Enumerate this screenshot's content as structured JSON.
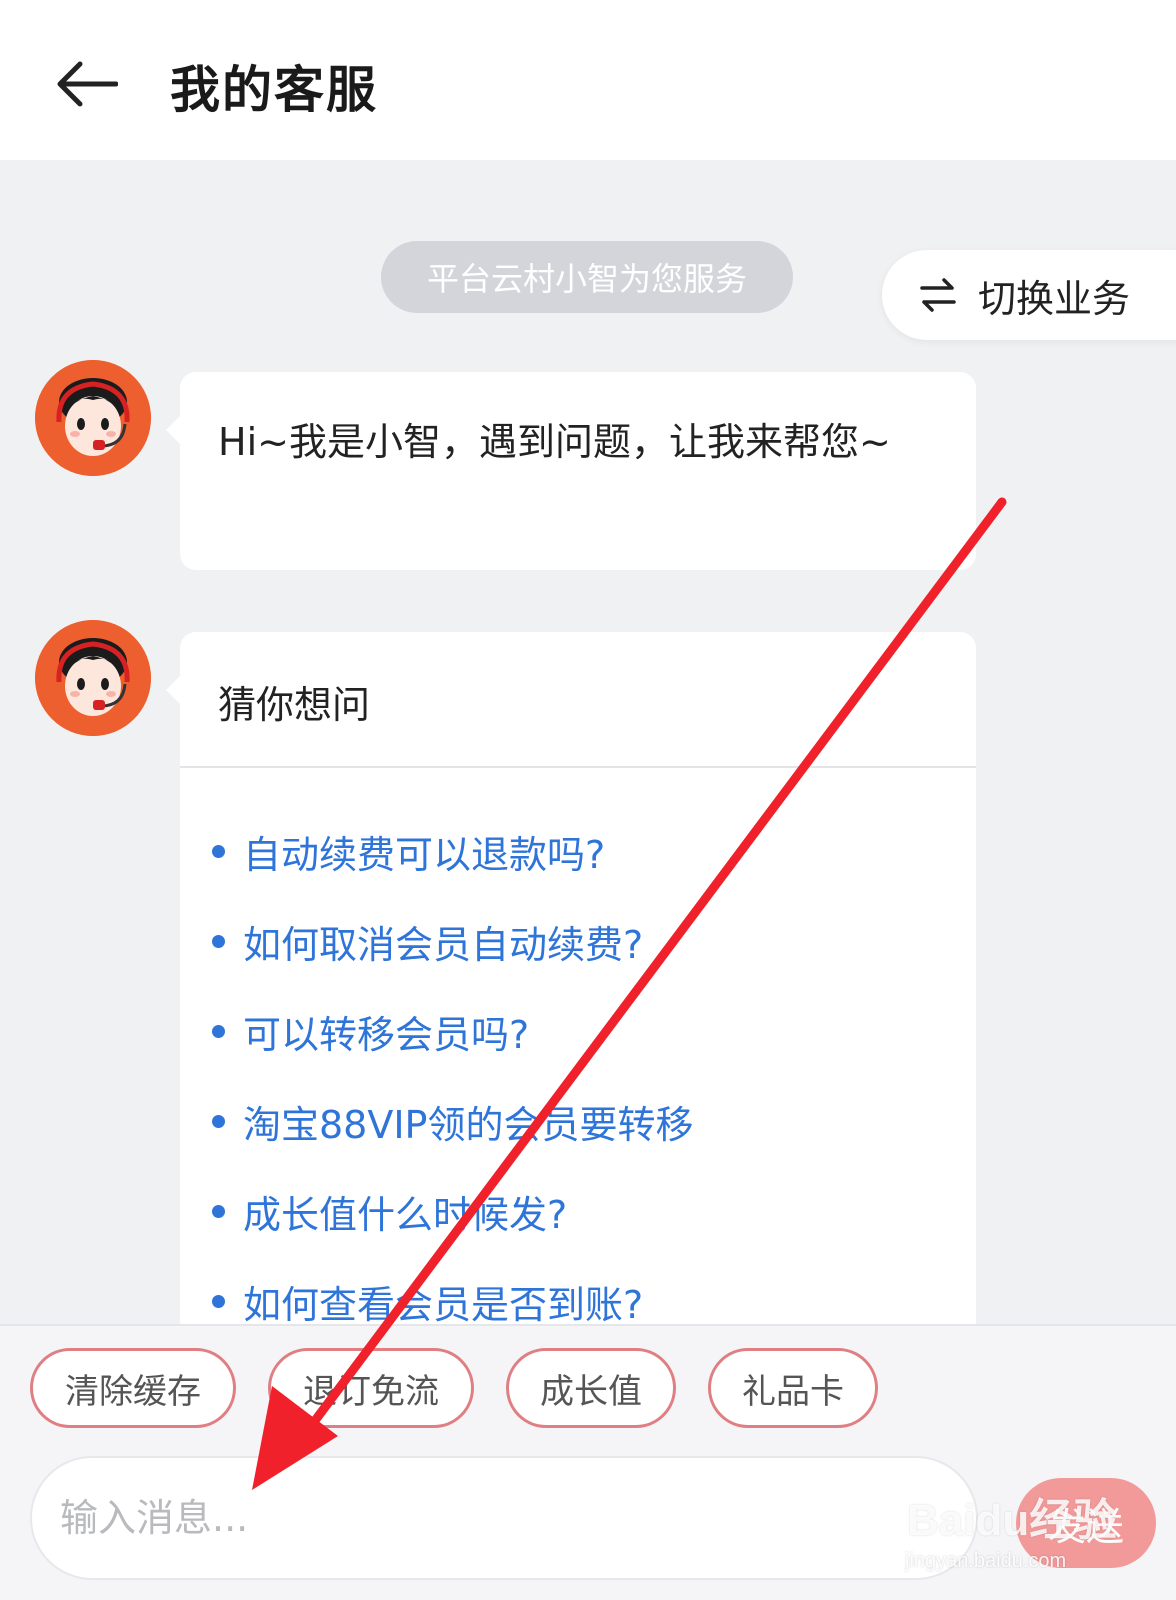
{
  "header": {
    "title": "我的客服"
  },
  "notice": {
    "text": "平台云村小智为您服务"
  },
  "switch_business": {
    "label": "切换业务"
  },
  "messages": [
    {
      "sender": "小智",
      "text": "Hi~我是小智，遇到问题，让我来帮您~"
    },
    {
      "sender": "小智",
      "title": "猜你想问",
      "faq": [
        "自动续费可以退款吗?",
        "如何取消会员自动续费?",
        "可以转移会员吗?",
        "淘宝88VIP领的会员要转移",
        "成长值什么时候发?",
        "如何查看会员是否到账?"
      ]
    }
  ],
  "quick_replies": [
    "清除缓存",
    "退订免流",
    "成长值",
    "礼品卡"
  ],
  "composer": {
    "placeholder": "输入消息...",
    "send_label": "发送"
  },
  "watermark": {
    "text": "Baidu经验",
    "url": "jingyan.baidu.com"
  },
  "colors": {
    "link": "#2e74d9",
    "chip_border": "#e07f83",
    "send_button": "#f29a9a",
    "avatar_bg": "#ee5f2f",
    "annotation_arrow": "#f0212b"
  }
}
